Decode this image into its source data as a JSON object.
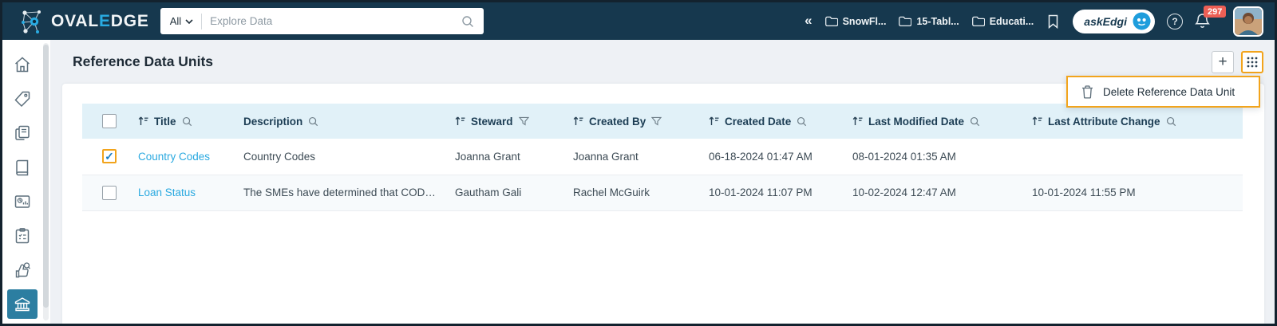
{
  "glyphs": {
    "collapse": "«",
    "plus": "+",
    "check": "✓",
    "help": "?"
  },
  "topbar": {
    "brand": {
      "pre": "OVAL",
      "accent": "E",
      "post": "DGE"
    },
    "search": {
      "scope_label": "All",
      "placeholder": "Explore Data"
    },
    "breadcrumbs": [
      {
        "label": "SnowFl..."
      },
      {
        "label": "15-Tabl..."
      },
      {
        "label": "Educati..."
      }
    ],
    "askedgi_label": "askEdgi",
    "notification_count": "297"
  },
  "sidebar": {
    "items": [
      {
        "icon": "home-icon",
        "active": false
      },
      {
        "icon": "tag-icon",
        "active": false
      },
      {
        "icon": "copy-pages-icon",
        "active": false
      },
      {
        "icon": "book-icon",
        "active": false
      },
      {
        "icon": "report-chart-icon",
        "active": false
      },
      {
        "icon": "checklist-icon",
        "active": false
      },
      {
        "icon": "endorse-hand-icon",
        "active": false
      },
      {
        "icon": "governance-bank-icon",
        "active": true
      }
    ]
  },
  "page": {
    "title": "Reference Data Units"
  },
  "actions_menu": {
    "items": [
      {
        "label": "Delete Reference Data Unit",
        "icon": "trash-icon"
      }
    ]
  },
  "table": {
    "columns": [
      {
        "label": "Title"
      },
      {
        "label": "Description"
      },
      {
        "label": "Steward"
      },
      {
        "label": "Created By"
      },
      {
        "label": "Created Date"
      },
      {
        "label": "Last Modified Date"
      },
      {
        "label": "Last Attribute Change"
      }
    ],
    "rows": [
      {
        "checked": true,
        "title": "Country Codes",
        "description": "Country Codes",
        "steward": "Joanna Grant",
        "created_by": "Joanna Grant",
        "created_date": "06-18-2024 01:47 AM",
        "last_modified_date": "08-01-2024 01:35 AM",
        "last_attribute_change": ""
      },
      {
        "checked": false,
        "title": "Loan Status",
        "description": "The SMEs have determined that CODED...",
        "steward": "Gautham Gali",
        "created_by": "Rachel McGuirk",
        "created_date": "10-01-2024 11:07 PM",
        "last_modified_date": "10-02-2024 12:47 AM",
        "last_attribute_change": "10-01-2024 11:55 PM"
      }
    ]
  },
  "colors": {
    "topbar_bg": "#16384E",
    "accent_cyan": "#29ABE2",
    "highlight_orange": "#F2A41C",
    "table_header_bg": "#E1F1F8",
    "badge_red": "#ED5F55",
    "sidebar_active_bg": "#2C7EA1",
    "link_blue": "#2AA9E0",
    "page_bg": "#EEF1F5"
  }
}
